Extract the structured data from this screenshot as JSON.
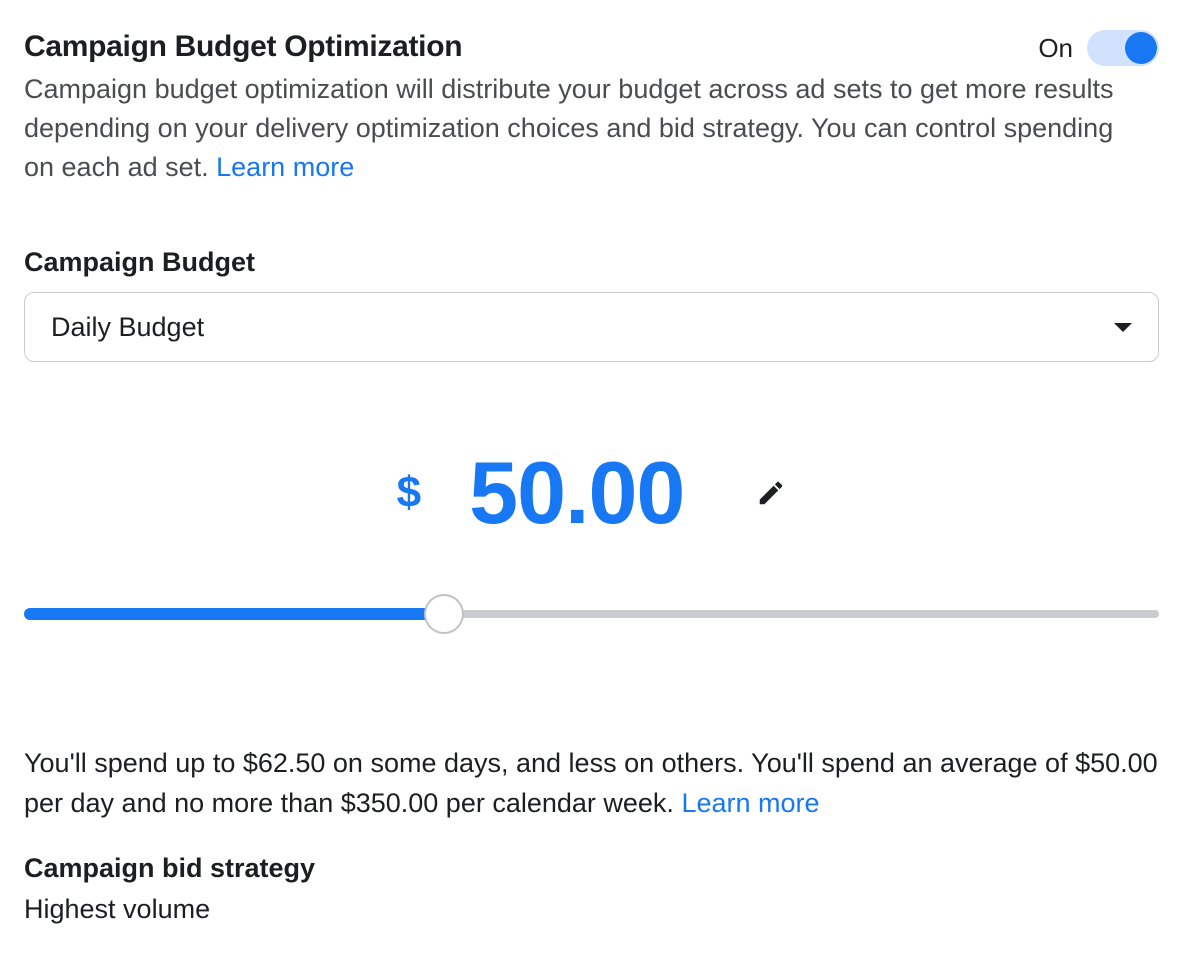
{
  "cbo": {
    "title": "Campaign Budget Optimization",
    "toggle_label": "On",
    "toggle_on": true,
    "description_1": "Campaign budget optimization will distribute your budget across ad sets to get more results depending on your delivery optimization choices and bid strategy. You can control spending on each ad set. ",
    "learn_more": "Learn more"
  },
  "budget": {
    "label": "Campaign Budget",
    "dropdown_value": "Daily Budget",
    "currency": "$",
    "amount": "50.00",
    "slider_percent": 37
  },
  "spend_note": {
    "text": "You'll spend up to $62.50 on some days, and less on others. You'll spend an average of $50.00 per day and no more than $350.00 per calendar week. ",
    "learn_more": "Learn more"
  },
  "bid_strategy": {
    "label": "Campaign bid strategy",
    "value": "Highest volume"
  }
}
